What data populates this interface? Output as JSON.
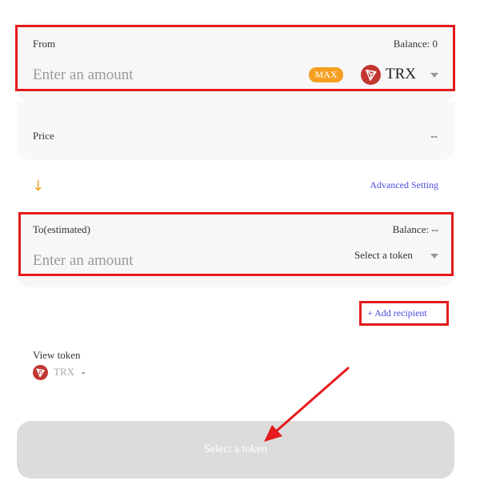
{
  "from": {
    "label": "From",
    "balance": "Balance: 0",
    "placeholder": "Enter an amount",
    "max_label": "MAX",
    "token": "TRX"
  },
  "price": {
    "label": "Price",
    "value": "--"
  },
  "advanced_setting": "Advanced Setting",
  "to": {
    "label": "To(estimated)",
    "balance": "Balance: --",
    "placeholder": "Enter an amount",
    "select_token": "Select a token"
  },
  "add_recipient": "+ Add recipient",
  "view_token": {
    "label": "View token",
    "token": "TRX",
    "dash": "-"
  },
  "submit_label": "Select a token",
  "colors": {
    "accent_orange": "#f5a023",
    "highlight_red": "#e41a1c",
    "link_blue": "#4a4adf",
    "tron_red": "#c23631"
  }
}
